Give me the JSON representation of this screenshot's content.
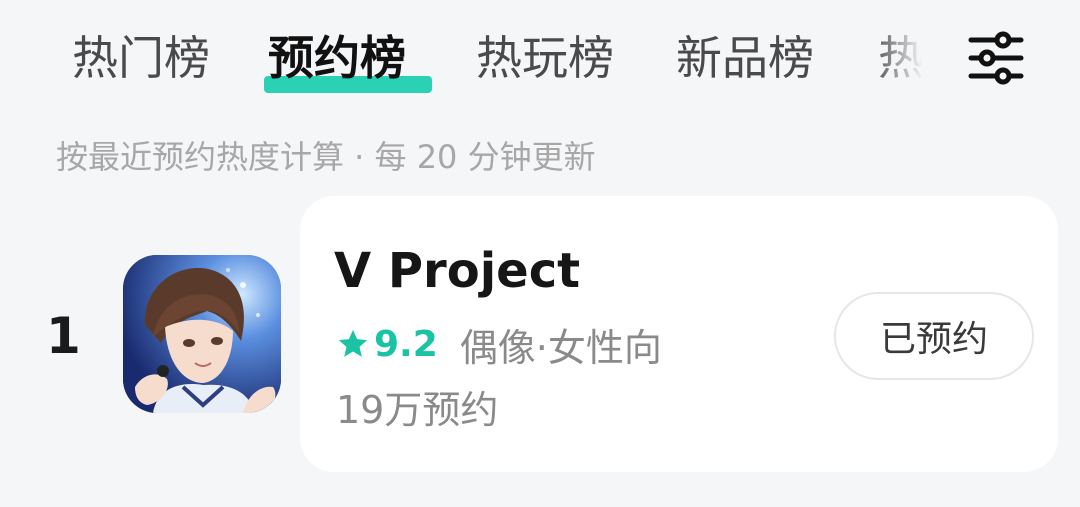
{
  "tabs": [
    {
      "label": "热门榜",
      "active": false
    },
    {
      "label": "预约榜",
      "active": true
    },
    {
      "label": "热玩榜",
      "active": false
    },
    {
      "label": "新品榜",
      "active": false
    },
    {
      "label": "热",
      "active": false
    }
  ],
  "filter_icon": "sliders-icon",
  "subtitle": "按最近预约热度计算 · 每 20 分钟更新",
  "list": [
    {
      "rank": "1",
      "title": "V Project",
      "rating": "9.2",
      "tags": "偶像·女性向",
      "reserve_count": "19万预约",
      "button_label": "已预约",
      "icon": "game-cover-art"
    }
  ],
  "colors": {
    "accent": "#2ad1b3",
    "rating": "#19c3a4",
    "background": "#f5f6f8",
    "card": "#ffffff"
  }
}
